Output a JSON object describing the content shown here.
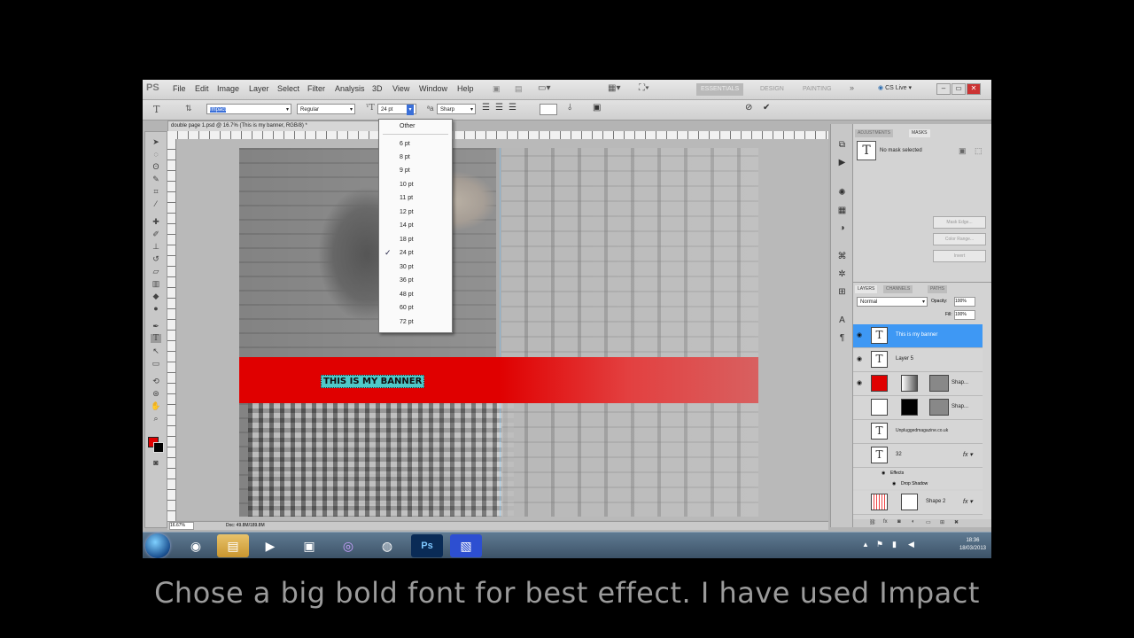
{
  "menubar": {
    "logo": "PS",
    "items": [
      "File",
      "Edit",
      "Image",
      "Layer",
      "Select",
      "Filter",
      "Analysis",
      "3D",
      "View",
      "Window",
      "Help"
    ],
    "workspaces": [
      "ESSENTIALS",
      "DESIGN",
      "PAINTING"
    ],
    "cs_live": "CS Live"
  },
  "options": {
    "font_family": "Impact",
    "font_style": "Regular",
    "font_size": "24 pt",
    "antialias": "Sharp"
  },
  "size_dropdown": {
    "options": [
      "Other",
      "6 pt",
      "8 pt",
      "9 pt",
      "10 pt",
      "11 pt",
      "12 pt",
      "14 pt",
      "18 pt",
      "24 pt",
      "30 pt",
      "36 pt",
      "48 pt",
      "60 pt",
      "72 pt"
    ],
    "selected": "24 pt"
  },
  "document": {
    "tab_title": "double page 1.psd @ 16.7% (This is my banner, RGB/8) *",
    "banner_text": "THIS IS MY BANNER",
    "zoom": "16.67%",
    "doc_size": "Doc: 49.8M/189.8M"
  },
  "panels": {
    "tabs_top": [
      "ADJUSTMENTS",
      "MASKS"
    ],
    "mask_status": "No mask selected",
    "mask_buttons": [
      "Mask Edge...",
      "Color Range...",
      "Invert"
    ],
    "tabs_layers": [
      "LAYERS",
      "CHANNELS",
      "PATHS"
    ],
    "blend_mode": "Normal",
    "opacity_label": "Opacity:",
    "opacity_value": "100%",
    "fill_label": "Fill:",
    "fill_value": "100%",
    "layers": [
      {
        "name": "This is my banner"
      },
      {
        "name": "Layer 5"
      },
      {
        "name": "Shap..."
      },
      {
        "name": "Shap..."
      },
      {
        "name": "Unpluggedmagazine.co.uk"
      },
      {
        "name": "32"
      },
      {
        "name": "Effects"
      },
      {
        "name": "Drop Shadow"
      },
      {
        "name": "Shape 2"
      }
    ]
  },
  "taskbar": {
    "time": "18:36",
    "date": "18/03/2013"
  },
  "caption": "Chose a big bold font for best effect. I have used Impact"
}
